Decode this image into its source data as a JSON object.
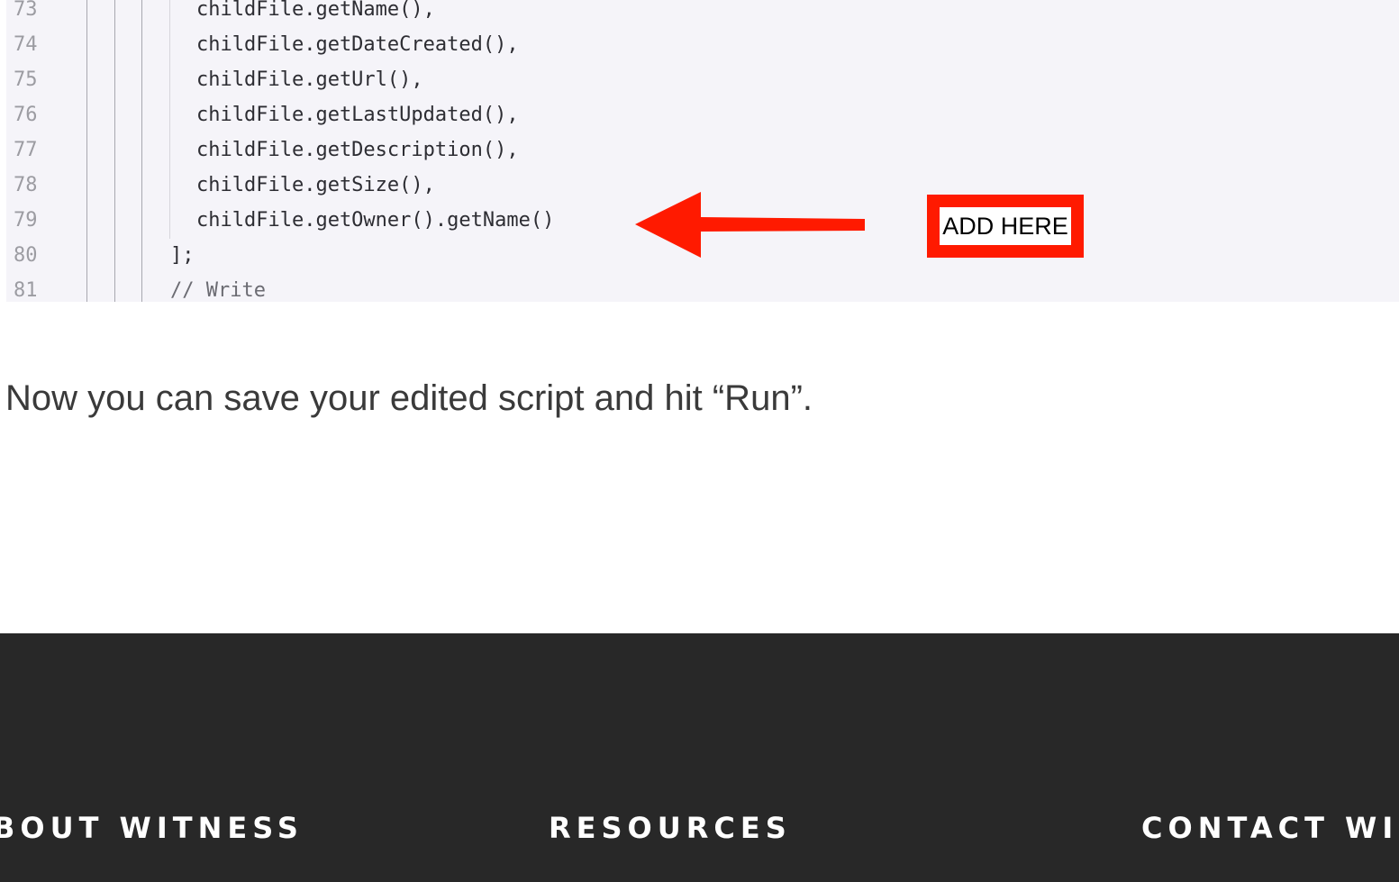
{
  "code": {
    "lines": [
      {
        "num": "73",
        "text": "childFile.getName(),"
      },
      {
        "num": "74",
        "text": "childFile.getDateCreated(),"
      },
      {
        "num": "75",
        "text": "childFile.getUrl(),"
      },
      {
        "num": "76",
        "text": "childFile.getLastUpdated(),"
      },
      {
        "num": "77",
        "text": "childFile.getDescription(),"
      },
      {
        "num": "78",
        "text": "childFile.getSize(),"
      },
      {
        "num": "79",
        "text": "childFile.getOwner().getName()"
      },
      {
        "num": "80",
        "text": "];"
      },
      {
        "num": "81",
        "text": "// Write"
      }
    ]
  },
  "annotation": {
    "label": "ADD HERE",
    "color": "#ff1a00"
  },
  "article": {
    "paragraph": "Now you can save your edited script and hit “Run”."
  },
  "footer": {
    "headings": [
      "BOUT WITNESS",
      "RESOURCES",
      "CONTACT WI"
    ]
  }
}
